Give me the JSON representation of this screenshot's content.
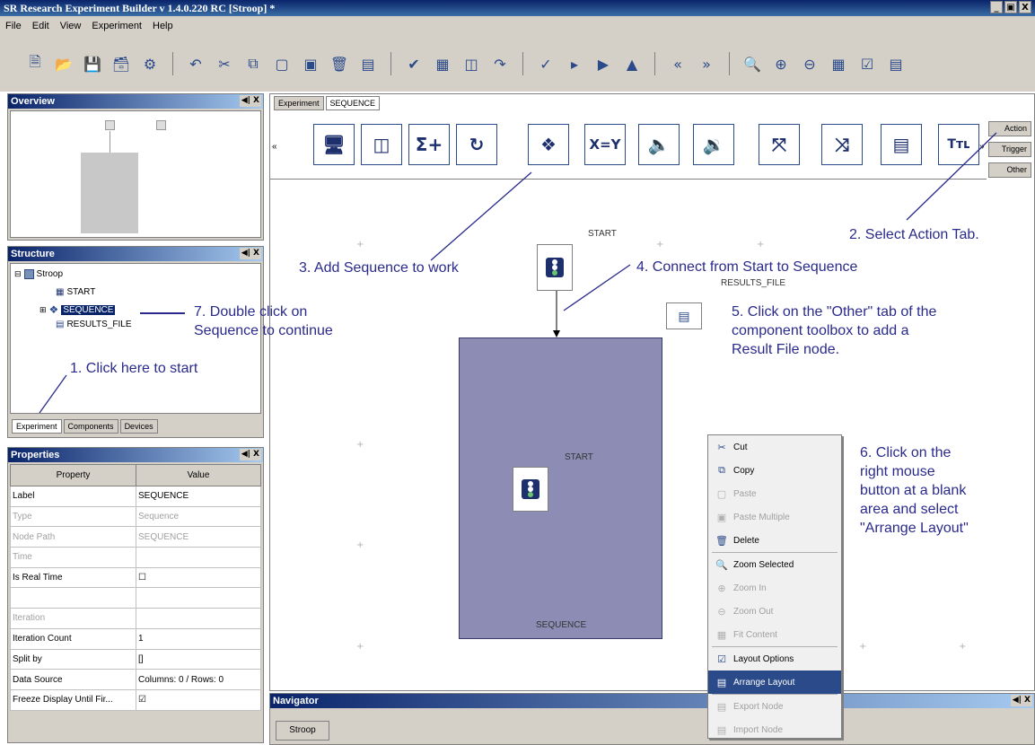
{
  "window": {
    "title": "SR Research Experiment Builder v 1.4.0.220 RC [Stroop] *",
    "buttons": [
      "_",
      "̴",
      "X"
    ]
  },
  "menu": [
    "File",
    "Edit",
    "View",
    "Experiment",
    "Help"
  ],
  "toolbar_icons": [
    "new-icon",
    "open-icon",
    "save-icon",
    "save-all-icon",
    "build-icon",
    "undo-icon",
    "cut-icon",
    "copy-icon",
    "paste-icon",
    "paste-multiple-icon",
    "delete-icon",
    "properties-icon",
    "check-icon",
    "chart-icon",
    "library-icon",
    "export-icon",
    "test-icon",
    "run-icon",
    "play-icon",
    "deploy-icon",
    "prev-icon",
    "next-icon",
    "zoom-icon",
    "zoom-in-icon",
    "zoom-out-icon",
    "fit-icon",
    "layout-options-icon",
    "arrange-layout-icon"
  ],
  "overview": {
    "title": "Overview"
  },
  "structure": {
    "title": "Structure",
    "root": "Stroop",
    "children": [
      "START",
      "SEQUENCE",
      "RESULTS_FILE"
    ],
    "tabs": [
      "Experiment",
      "Components",
      "Devices"
    ]
  },
  "properties": {
    "title": "Properties",
    "headers": [
      "Property",
      "Value"
    ],
    "rows": [
      {
        "property": "Label",
        "value": "SEQUENCE",
        "grey": false
      },
      {
        "property": "Type",
        "value": "Sequence",
        "grey": true
      },
      {
        "property": "Node Path",
        "value": "SEQUENCE",
        "grey": true
      },
      {
        "property": "Time",
        "value": "",
        "grey": true
      },
      {
        "property": "Is Real Time",
        "value": "☐",
        "grey": false
      },
      {
        "property": "",
        "value": "",
        "grey": false
      },
      {
        "property": "Iteration",
        "value": "",
        "grey": true
      },
      {
        "property": "Iteration Count",
        "value": "1",
        "grey": false
      },
      {
        "property": "Split by",
        "value": "[]",
        "grey": false
      },
      {
        "property": "Data Source",
        "value": "Columns: 0 / Rows: 0",
        "grey": false
      },
      {
        "property": "Freeze Display Until Fir...",
        "value": "☑",
        "grey": false
      }
    ]
  },
  "editor_tabs": [
    "Experiment",
    "SEQUENCE"
  ],
  "components": [
    "display-screen-icon",
    "sequence-container-icon",
    "add-to-accumulator-icon",
    "loop-icon",
    "sequence-icon",
    "update-attribute-icon",
    "play-sound-icon",
    "play-sound-control-icon",
    "drift-correct-icon",
    "camera-setup-icon",
    "send-message-icon",
    "text-resource-icon"
  ],
  "component_labels": {
    "sum": "Σ+",
    "assign": "X=Y",
    "text": "Tтʟ"
  },
  "side_tabs": [
    "Action",
    "Trigger",
    "Other"
  ],
  "canvas_labels": {
    "start_top": "START",
    "results_file": "RESULTS_FILE",
    "start_inner": "START",
    "sequence_label": "SEQUENCE"
  },
  "context_menu": [
    {
      "label": "Cut",
      "icon": "cut-icon",
      "disabled": false,
      "highlight": false
    },
    {
      "label": "Copy",
      "icon": "copy-icon",
      "disabled": false,
      "highlight": false
    },
    {
      "label": "Paste",
      "icon": "paste-icon",
      "disabled": true,
      "highlight": false
    },
    {
      "label": "Paste Multiple",
      "icon": "paste-multiple-icon",
      "disabled": true,
      "highlight": false
    },
    {
      "label": "Delete",
      "icon": "delete-icon",
      "disabled": false,
      "highlight": false
    },
    {
      "label": "Zoom Selected",
      "icon": "zoom-selected-icon",
      "disabled": false,
      "highlight": false
    },
    {
      "label": "Zoom In",
      "icon": "zoom-in-icon",
      "disabled": true,
      "highlight": false
    },
    {
      "label": "Zoom Out",
      "icon": "zoom-out-icon",
      "disabled": true,
      "highlight": false
    },
    {
      "label": "Fit Content",
      "icon": "fit-content-icon",
      "disabled": true,
      "highlight": false
    },
    {
      "label": "Layout Options",
      "icon": "layout-options-icon",
      "disabled": false,
      "highlight": false
    },
    {
      "label": "Arrange Layout",
      "icon": "arrange-layout-icon",
      "disabled": false,
      "highlight": true
    },
    {
      "label": "Export Node",
      "icon": "export-node-icon",
      "disabled": true,
      "highlight": false
    },
    {
      "label": "Import Node",
      "icon": "import-node-icon",
      "disabled": true,
      "highlight": false
    }
  ],
  "navigator": {
    "title": "Navigator",
    "button": "Stroop"
  },
  "annotations": {
    "a1": "1. Click here to start",
    "a2": "2. Select Action Tab.",
    "a3": "3. Add Sequence to work",
    "a4": "4. Connect from Start to Sequence",
    "a5_l1": "5. Click on the \"Other\" tab of the",
    "a5_l2": "component toolbox to add a",
    "a5_l3": "Result File node.",
    "a6_l1": "6. Click on the",
    "a6_l2": "right mouse",
    "a6_l3": "button at a blank",
    "a6_l4": "area and select",
    "a6_l5": "\"Arrange Layout\"",
    "a7_l1": "7. Double click on",
    "a7_l2": "Sequence to continue"
  },
  "colors": {
    "annotation": "#2a2a8c",
    "sequence_fill": "#8c8cb4",
    "title_bar": "#0a246a"
  }
}
